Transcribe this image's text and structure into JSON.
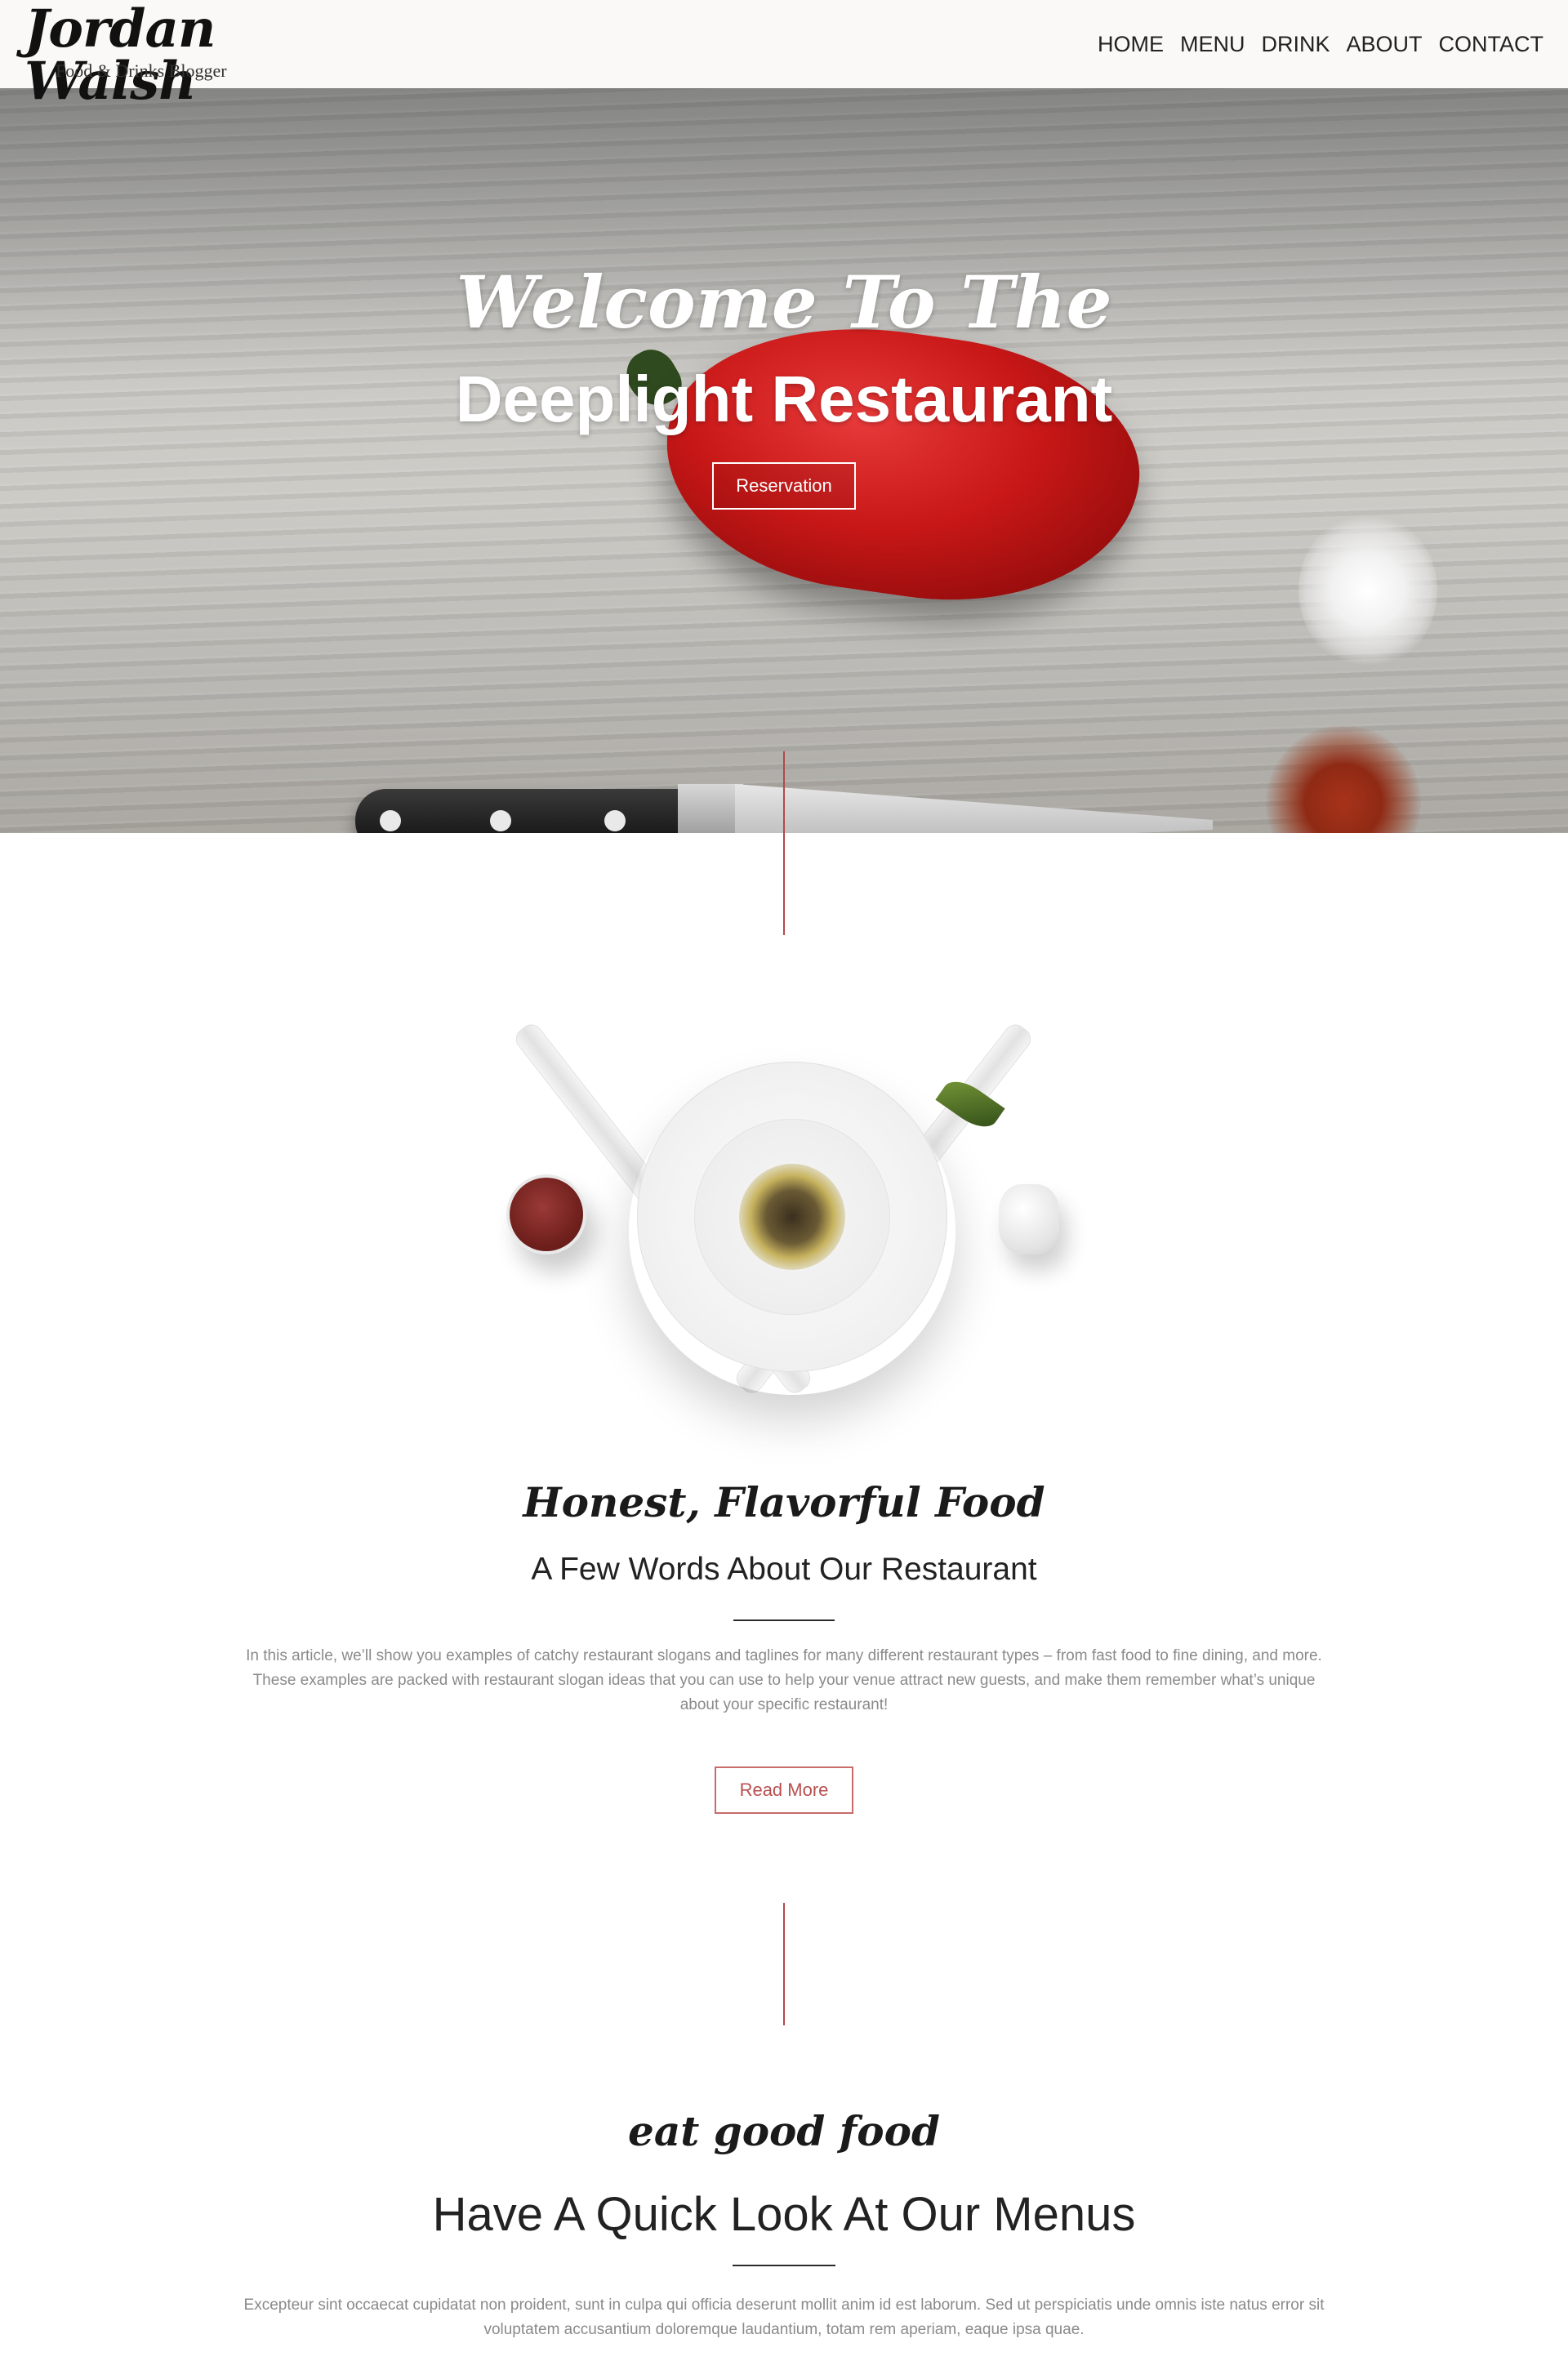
{
  "header": {
    "logo_name": "Jordan Walsh",
    "logo_subtitle": "Food & Drinks Blogger",
    "nav": [
      "HOME",
      "MENU",
      "DRINK",
      "ABOUT",
      "CONTACT"
    ]
  },
  "hero": {
    "welcome": "Welcome To The",
    "title": "Deeplight Restaurant",
    "button_label": "Reservation"
  },
  "about": {
    "script_title": "Honest, Flavorful Food",
    "title": "A Few Words About Our Restaurant",
    "paragraph_lines": [
      "In this article, we’ll show you examples of catchy restaurant slogans and taglines for many different restaurant types – from fast food to fine dining, and more.",
      "These examples are packed with restaurant slogan ideas that you can use to help your venue attract new guests, and make them remember what’s unique",
      "about your specific restaurant!"
    ],
    "button_label": "Read More"
  },
  "menus": {
    "script_title": "eat good food",
    "title": "Have A Quick Look At Our Menus",
    "paragraph_lines": [
      "Excepteur sint occaecat cupidatat non proident, sunt in culpa qui officia deserunt mollit anim id est laborum. Sed ut perspiciatis unde omnis iste natus error sit",
      "voluptatem accusantium doloremque laudantium, totam rem aperiam, eaque ipsa quae."
    ]
  },
  "colors": {
    "accent": "#b84f4f",
    "header_bg": "#faf9f7",
    "text_muted": "#8a8a8a"
  }
}
